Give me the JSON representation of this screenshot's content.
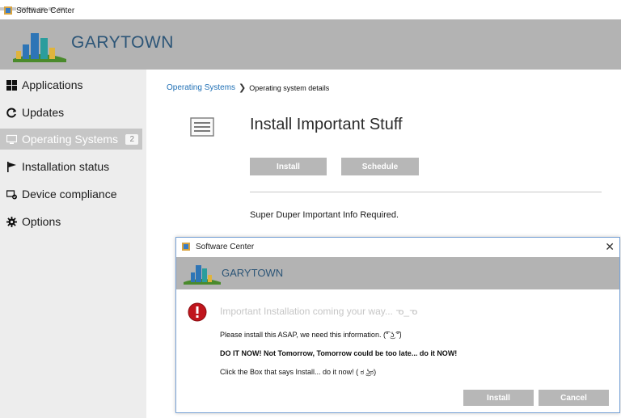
{
  "window": {
    "title": "Software Center"
  },
  "brand": {
    "name": "GARYTOWN"
  },
  "sidebar": {
    "items": [
      {
        "label": "Applications",
        "icon": "apps-grid-icon"
      },
      {
        "label": "Updates",
        "icon": "refresh-icon"
      },
      {
        "label": "Operating Systems",
        "icon": "monitor-icon",
        "badge": "2",
        "active": true
      },
      {
        "label": "Installation status",
        "icon": "flag-icon"
      },
      {
        "label": "Device compliance",
        "icon": "device-compliance-icon"
      },
      {
        "label": "Options",
        "icon": "gear-icon"
      }
    ]
  },
  "breadcrumb": {
    "parent": "Operating Systems",
    "separator": "❯",
    "current": "Operating system details"
  },
  "details": {
    "title": "Install Important Stuff",
    "install_label": "Install",
    "schedule_label": "Schedule",
    "info": "Super Duper Important Info Required."
  },
  "dialog": {
    "title": "Software Center",
    "brand": "GARYTOWN",
    "heading": "Important Installation coming your way... ᓀ_ᓀ",
    "line1": "Please install this ASAP, we need this information. (͡° ͜ʖ ͡°)",
    "line2": "DO IT NOW!  Not Tomorrow, Tomorrow could be too late... do it NOW!",
    "line3": "Click the Box that says Install... do it now! ( ಠ ͜ʖಠ)",
    "install_label": "Install",
    "cancel_label": "Cancel",
    "close_glyph": "✕"
  },
  "colors": {
    "banner": "#b3b3b3",
    "brand": "#2c5577",
    "link": "#1e6fb5",
    "button": "#b7b7b7",
    "error": "#c0151c"
  }
}
